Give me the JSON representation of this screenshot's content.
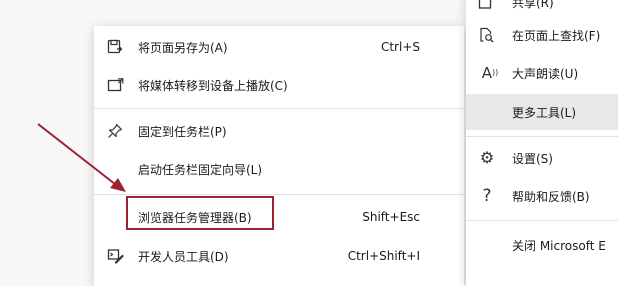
{
  "left_menu": {
    "items": [
      {
        "label": "将页面另存为(A)",
        "shortcut": "Ctrl+S",
        "icon": "save-page-icon"
      },
      {
        "label": "将媒体转移到设备上播放(C)",
        "shortcut": "",
        "icon": "cast-media-icon"
      },
      {
        "label": "固定到任务栏(P)",
        "shortcut": "",
        "icon": "pin-icon"
      },
      {
        "label": "启动任务栏固定向导(L)",
        "shortcut": "",
        "icon": ""
      },
      {
        "label": "浏览器任务管理器(B)",
        "shortcut": "Shift+Esc",
        "icon": "",
        "highlighted": true
      },
      {
        "label": "开发人员工具(D)",
        "shortcut": "Ctrl+Shift+I",
        "icon": "developer-tools-icon"
      }
    ]
  },
  "right_menu": {
    "items": [
      {
        "label": "共享(R)",
        "icon": "share-icon"
      },
      {
        "label": "在页面上查找(F)",
        "icon": "find-on-page-icon"
      },
      {
        "label": "大声朗读(U)",
        "icon": "read-aloud-icon"
      },
      {
        "label": "更多工具(L)",
        "icon": "",
        "highlighted": true
      },
      {
        "label": "设置(S)",
        "icon": "settings-gear-icon"
      },
      {
        "label": "帮助和反馈(B)",
        "icon": "help-question-icon"
      },
      {
        "label": "关闭 Microsoft E",
        "icon": ""
      }
    ]
  },
  "colors": {
    "annotation": "#9b2335",
    "highlight": "#e8e8e8"
  }
}
